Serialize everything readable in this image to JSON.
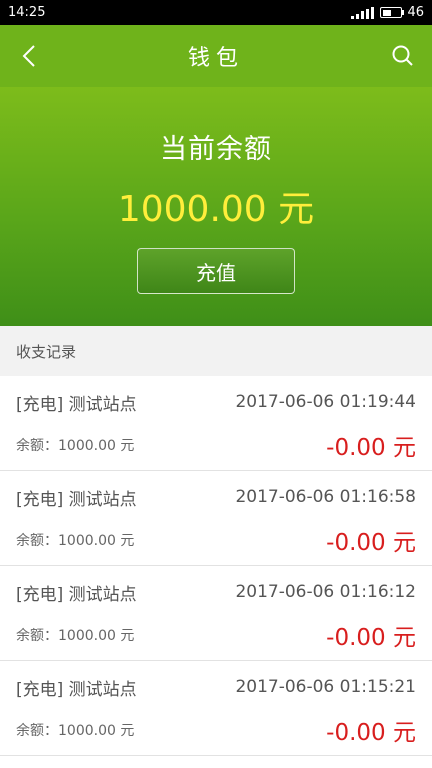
{
  "status_bar": {
    "time": "14:25",
    "battery_level": "46"
  },
  "header": {
    "title": "钱包",
    "back_icon": "chevron-left-icon",
    "search_icon": "search-icon"
  },
  "balance_card": {
    "label": "当前余额",
    "amount": "1000.00 元",
    "recharge_label": "充值"
  },
  "records_section": {
    "title": "收支记录"
  },
  "records": [
    {
      "type": "[充电]",
      "site": "测试站点",
      "time": "2017-06-06 01:19:44",
      "remaining_label": "余额：",
      "remaining": "1000.00 元",
      "amount": "-0.00 元"
    },
    {
      "type": "[充电]",
      "site": "测试站点",
      "time": "2017-06-06 01:16:58",
      "remaining_label": "余额：",
      "remaining": "1000.00 元",
      "amount": "-0.00 元"
    },
    {
      "type": "[充电]",
      "site": "测试站点",
      "time": "2017-06-06 01:16:12",
      "remaining_label": "余额：",
      "remaining": "1000.00 元",
      "amount": "-0.00 元"
    },
    {
      "type": "[充电]",
      "site": "测试站点",
      "time": "2017-06-06 01:15:21",
      "remaining_label": "余额：",
      "remaining": "1000.00 元",
      "amount": "-0.00 元"
    }
  ],
  "colors": {
    "header_green": "#6fb31b",
    "balance_yellow": "#ffee3b",
    "amount_red": "#d81e1e"
  }
}
